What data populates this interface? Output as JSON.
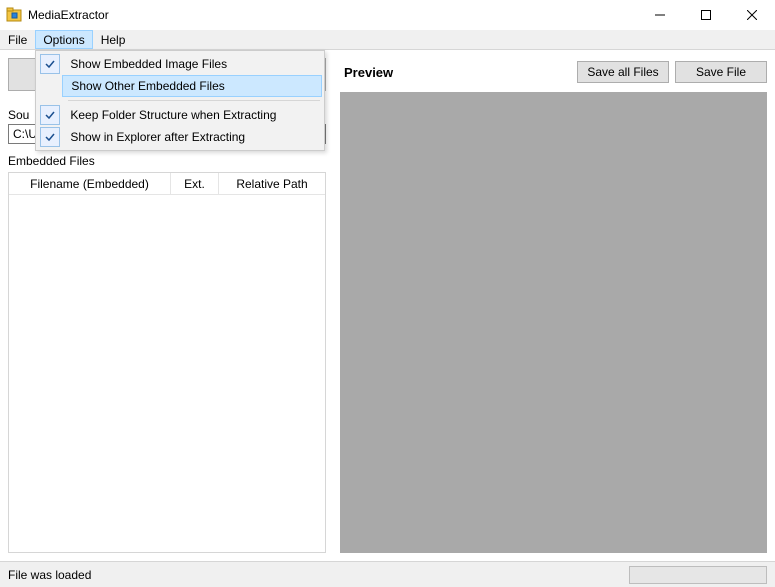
{
  "window": {
    "title": "MediaExtractor"
  },
  "menu": {
    "file": "File",
    "options": "Options",
    "help": "Help"
  },
  "options_menu": {
    "show_images": "Show Embedded Image Files",
    "show_other": "Show Other Embedded Files",
    "keep_folder": "Keep Folder Structure when Extracting",
    "show_explorer": "Show in Explorer after Extracting"
  },
  "left": {
    "source_label_partial": "Sou",
    "source_value": "C:\\U",
    "embedded_label": "Embedded Files",
    "columns": {
      "filename": "Filename (Embedded)",
      "ext": "Ext.",
      "relpath": "Relative Path"
    }
  },
  "preview": {
    "title": "Preview",
    "save_all": "Save all Files",
    "save_file": "Save File"
  },
  "status": {
    "text": "File was loaded"
  }
}
